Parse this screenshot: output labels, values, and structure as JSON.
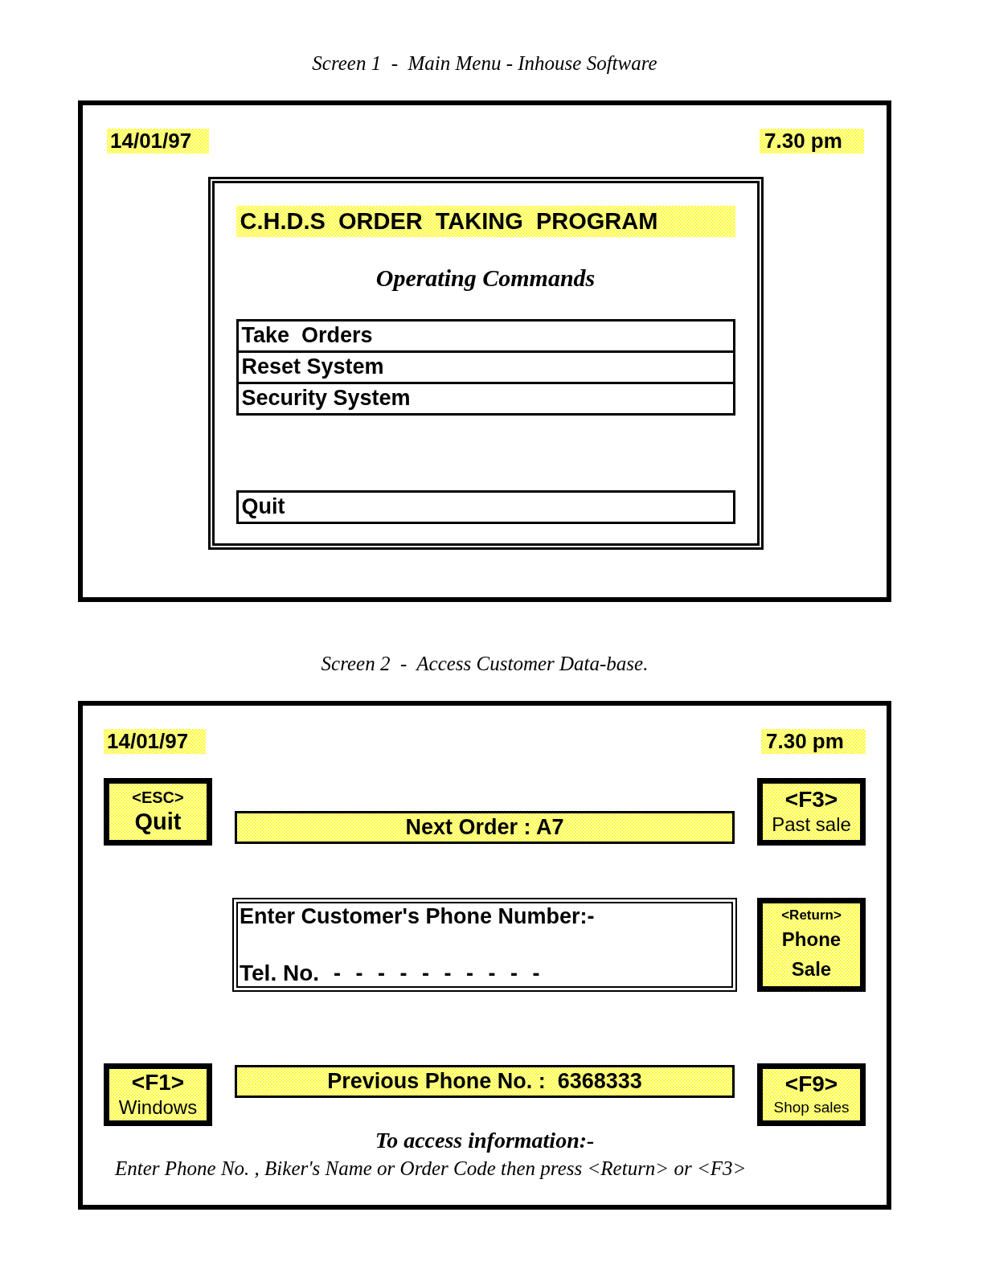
{
  "screens": [
    {
      "kind": "main_menu",
      "caption": "Screen 1  -  Main Menu - Inhouse Software",
      "date": "14/01/97",
      "time": "7.30 pm",
      "program_title": "C.H.D.S  ORDER  TAKING  PROGRAM",
      "heading": "Operating Commands",
      "commands": [
        "Take  Orders",
        "Reset System",
        "Security System"
      ],
      "quit_command": "Quit"
    },
    {
      "kind": "customer_lookup",
      "caption": "Screen 2  -  Access Customer Data-base.",
      "date": "14/01/97",
      "time": "7.30 pm",
      "left_keys": [
        {
          "key": "<ESC>",
          "action": "Quit"
        },
        {
          "key": "<F1>",
          "action": "Windows"
        }
      ],
      "right_keys": [
        {
          "key": "<F3>",
          "action": "Past sale"
        },
        {
          "key": "<Return>",
          "action": "Phone Sale"
        },
        {
          "key": "<F9>",
          "action": "Shop sales"
        }
      ],
      "next_order": "Next Order : A7",
      "phone_entry": {
        "prompt": "Enter Customer's Phone Number:-",
        "label": "Tel. No.",
        "placeholder": "- - - - - - - - - -"
      },
      "previous_phone": "Previous Phone No. :  6368333",
      "instructions": {
        "heading": "To access information:-",
        "text": "Enter Phone No. , Biker's Name or Order Code then press <Return> or <F3>"
      }
    }
  ]
}
